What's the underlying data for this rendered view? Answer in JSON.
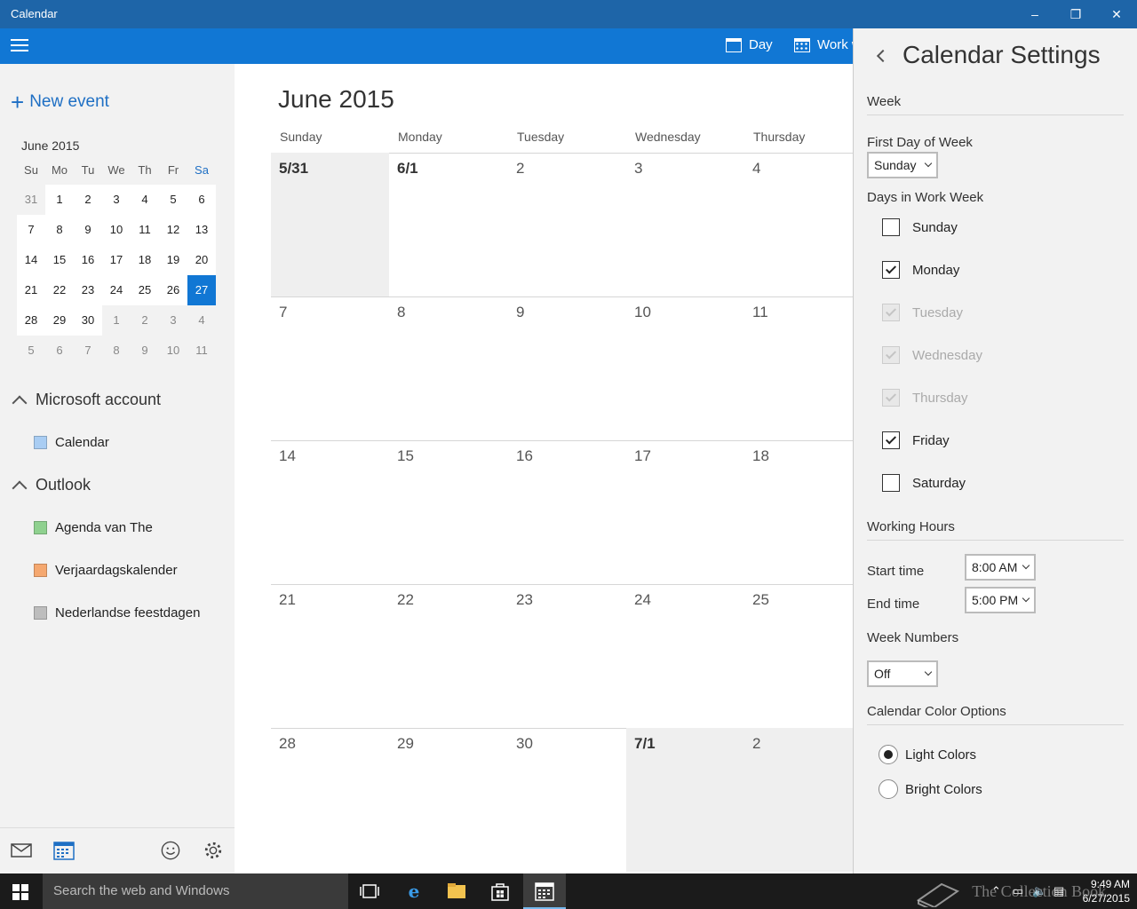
{
  "window": {
    "title": "Calendar",
    "minimize": "–",
    "restore": "❐",
    "close": "✕"
  },
  "toolbar": {
    "day_label": "Day",
    "work_week_label": "Work w"
  },
  "sidebar": {
    "new_event": "New event",
    "mini_month_title": "June 2015",
    "weekday_headers": [
      "Su",
      "Mo",
      "Tu",
      "We",
      "Th",
      "Fr",
      "Sa"
    ],
    "mini_weeks": [
      [
        "31",
        "1",
        "2",
        "3",
        "4",
        "5",
        "6"
      ],
      [
        "7",
        "8",
        "9",
        "10",
        "11",
        "12",
        "13"
      ],
      [
        "14",
        "15",
        "16",
        "17",
        "18",
        "19",
        "20"
      ],
      [
        "21",
        "22",
        "23",
        "24",
        "25",
        "26",
        "27"
      ],
      [
        "28",
        "29",
        "30",
        "1",
        "2",
        "3",
        "4"
      ],
      [
        "5",
        "6",
        "7",
        "8",
        "9",
        "10",
        "11"
      ]
    ],
    "today": "27",
    "accounts": [
      {
        "name": "Microsoft account",
        "calendars": [
          {
            "name": "Calendar",
            "color": "#a9cdf3"
          }
        ]
      },
      {
        "name": "Outlook",
        "calendars": [
          {
            "name": "Agenda van The",
            "color": "#8fd18f"
          },
          {
            "name": "Verjaardagskalender",
            "color": "#f5a870"
          },
          {
            "name": "Nederlandse feestdagen",
            "color": "#bdbdbd"
          }
        ]
      }
    ]
  },
  "month_view": {
    "title": "June 2015",
    "day_headers": [
      "Sunday",
      "Monday",
      "Tuesday",
      "Wednesday",
      "Thursday"
    ],
    "weeks": [
      [
        "5/31",
        "6/1",
        "2",
        "3",
        "4"
      ],
      [
        "7",
        "8",
        "9",
        "10",
        "11"
      ],
      [
        "14",
        "15",
        "16",
        "17",
        "18"
      ],
      [
        "21",
        "22",
        "23",
        "24",
        "25"
      ],
      [
        "28",
        "29",
        "30",
        "7/1",
        "2"
      ]
    ]
  },
  "settings": {
    "title": "Calendar Settings",
    "week_section": "Week",
    "first_day_label": "First Day of Week",
    "first_day_value": "Sunday",
    "work_week_label": "Days in Work Week",
    "work_days": [
      {
        "name": "Sunday",
        "checked": false,
        "disabled": false
      },
      {
        "name": "Monday",
        "checked": true,
        "disabled": false
      },
      {
        "name": "Tuesday",
        "checked": true,
        "disabled": true
      },
      {
        "name": "Wednesday",
        "checked": true,
        "disabled": true
      },
      {
        "name": "Thursday",
        "checked": true,
        "disabled": true
      },
      {
        "name": "Friday",
        "checked": true,
        "disabled": false
      },
      {
        "name": "Saturday",
        "checked": false,
        "disabled": false
      }
    ],
    "working_hours_section": "Working Hours",
    "start_time_label": "Start time",
    "start_time_value": "8:00 AM",
    "end_time_label": "End time",
    "end_time_value": "5:00 PM",
    "week_numbers_section": "Week Numbers",
    "week_numbers_value": "Off",
    "color_options_section": "Calendar Color Options",
    "color_options": [
      {
        "name": "Light Colors",
        "selected": true
      },
      {
        "name": "Bright Colors",
        "selected": false
      }
    ]
  },
  "taskbar": {
    "search_placeholder": "Search the web and Windows",
    "time": "9:49 AM",
    "date": "6/27/2015",
    "watermark": "The Collection Book"
  },
  "colors": {
    "title_bar": "#1e65a8",
    "toolbar": "#1177d4",
    "accent": "#1e6fc4"
  }
}
